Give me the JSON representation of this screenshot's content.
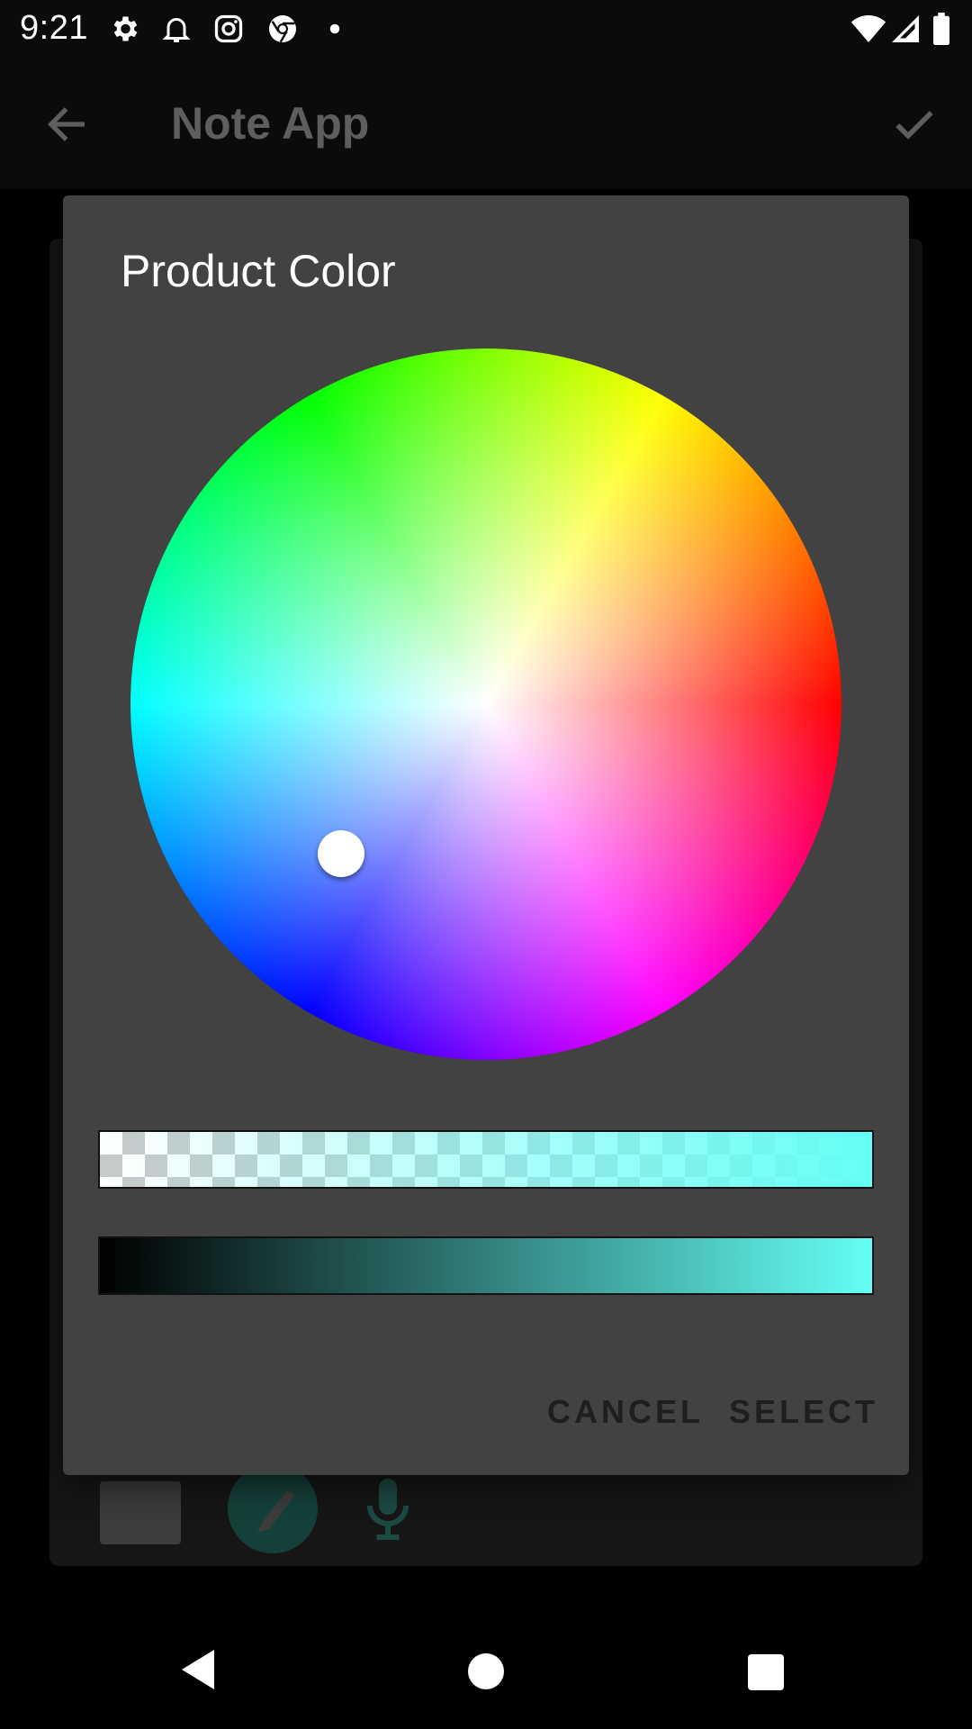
{
  "status_bar": {
    "time": "9:21",
    "left_icons": [
      "gear-icon",
      "notification-bell-icon",
      "instagram-icon",
      "chrome-icon",
      "dot-icon"
    ],
    "right_icons": [
      "wifi-icon",
      "signal-icon",
      "battery-icon"
    ]
  },
  "app_bar": {
    "title": "Note App",
    "back_icon": "arrow-back-icon",
    "confirm_icon": "check-icon"
  },
  "dialog": {
    "title": "Product Color",
    "selected_color": "#64fff6",
    "cancel_label": "CANCEL",
    "select_label": "SELECT"
  },
  "colors": {
    "dialog_bg": "#424242",
    "appbar_bg": "#0b0b0b",
    "selected": "#64fff6"
  }
}
